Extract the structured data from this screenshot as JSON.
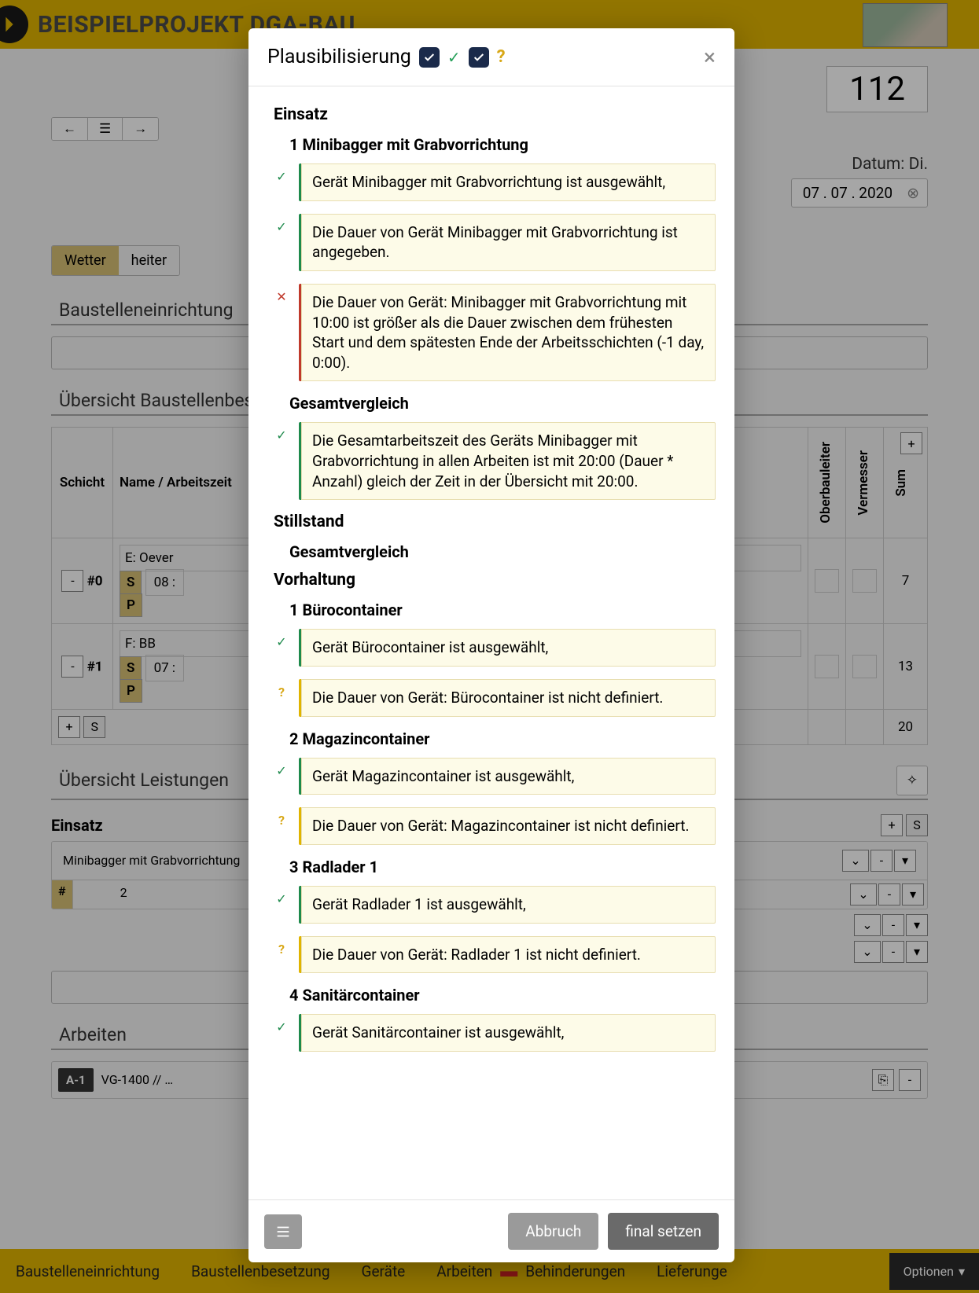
{
  "topbar": {
    "project_title": "BEISPIELPROJEKT DGA-BAU"
  },
  "page_number": "112",
  "date_label": "Datum: Di.",
  "date_value": "07 . 07 . 2020",
  "weather_tabs": {
    "a": "Wetter",
    "b": "heiter"
  },
  "sections": {
    "baustelleneinr": "Baustelleneinrichtung",
    "besetzung": "Übersicht Baustellenbesetzung",
    "leistung": "Übersicht Leistungen",
    "arbeiten": "Arbeiten"
  },
  "table": {
    "col_schicht": "Schicht",
    "col_name": "Name / Arbeitszeit",
    "col_ober": "Oberbauleiter",
    "col_verm": "Vermesser",
    "col_sum": "Sum",
    "rows": [
      {
        "tag": "#0",
        "line1": "E: Oever",
        "time": "08 :",
        "sum": "7"
      },
      {
        "tag": "#1",
        "line1": "F: BB",
        "time": "07 :",
        "sum": "13"
      }
    ],
    "total": "20",
    "s_label": "S",
    "p_label": "P",
    "add": "+",
    "remove": "-"
  },
  "einsatz": {
    "h": "Einsatz",
    "item": "Minibagger mit Grabvorrichtung",
    "hash": "#",
    "count": "2",
    "add": "+",
    "s": "S",
    "minus": "-"
  },
  "work": {
    "a1": "A-1",
    "desc": "VG-1400 // …"
  },
  "bottom_nav": {
    "a": "Baustelleneinrichtung",
    "b": "Baustellenbesetzung",
    "c": "Geräte",
    "d": "Arbeiten",
    "e": "Behinderungen",
    "f": "Lieferunge",
    "opt": "Optionen"
  },
  "modal": {
    "title": "Plausibilisierung",
    "footer": {
      "cancel": "Abbruch",
      "final": "final setzen"
    },
    "sections": [
      {
        "type": "h1",
        "text": "Einsatz"
      },
      {
        "type": "h2",
        "text": "1 Minibagger mit Grabvorrichtung"
      },
      {
        "type": "ok",
        "text": "Gerät Minibagger mit Grabvorrichtung ist ausgewählt,"
      },
      {
        "type": "ok",
        "text": "Die Dauer von Gerät Minibagger mit Grabvorrichtung ist angegeben."
      },
      {
        "type": "err",
        "text": "Die Dauer von Gerät: Minibagger mit Grabvorrichtung mit 10:00 ist größer als die Dauer zwischen dem frühesten Start und dem spätesten Ende der Arbeitsschichten (-1 day, 0:00)."
      },
      {
        "type": "h2",
        "text": "Gesamtvergleich"
      },
      {
        "type": "ok",
        "text": "Die Gesamtarbeitszeit des Geräts Minibagger mit Grabvorrichtung in allen Arbeiten ist mit 20:00 (Dauer * Anzahl) gleich der Zeit in der Übersicht mit 20:00."
      },
      {
        "type": "h1",
        "text": "Stillstand"
      },
      {
        "type": "h2",
        "text": "Gesamtvergleich"
      },
      {
        "type": "h1",
        "text": "Vorhaltung"
      },
      {
        "type": "h2",
        "text": "1 Bürocontainer"
      },
      {
        "type": "ok",
        "text": "Gerät Bürocontainer ist ausgewählt,"
      },
      {
        "type": "warn",
        "text": "Die Dauer von Gerät: Bürocontainer ist nicht definiert."
      },
      {
        "type": "h2",
        "text": "2 Magazincontainer"
      },
      {
        "type": "ok",
        "text": "Gerät Magazincontainer ist ausgewählt,"
      },
      {
        "type": "warn",
        "text": "Die Dauer von Gerät: Magazincontainer ist nicht definiert."
      },
      {
        "type": "h2",
        "text": "3 Radlader 1"
      },
      {
        "type": "ok",
        "text": "Gerät Radlader 1 ist ausgewählt,"
      },
      {
        "type": "warn",
        "text": "Die Dauer von Gerät: Radlader 1 ist nicht definiert."
      },
      {
        "type": "h2",
        "text": "4 Sanitärcontainer"
      },
      {
        "type": "ok",
        "text": "Gerät Sanitärcontainer ist ausgewählt,"
      }
    ]
  }
}
